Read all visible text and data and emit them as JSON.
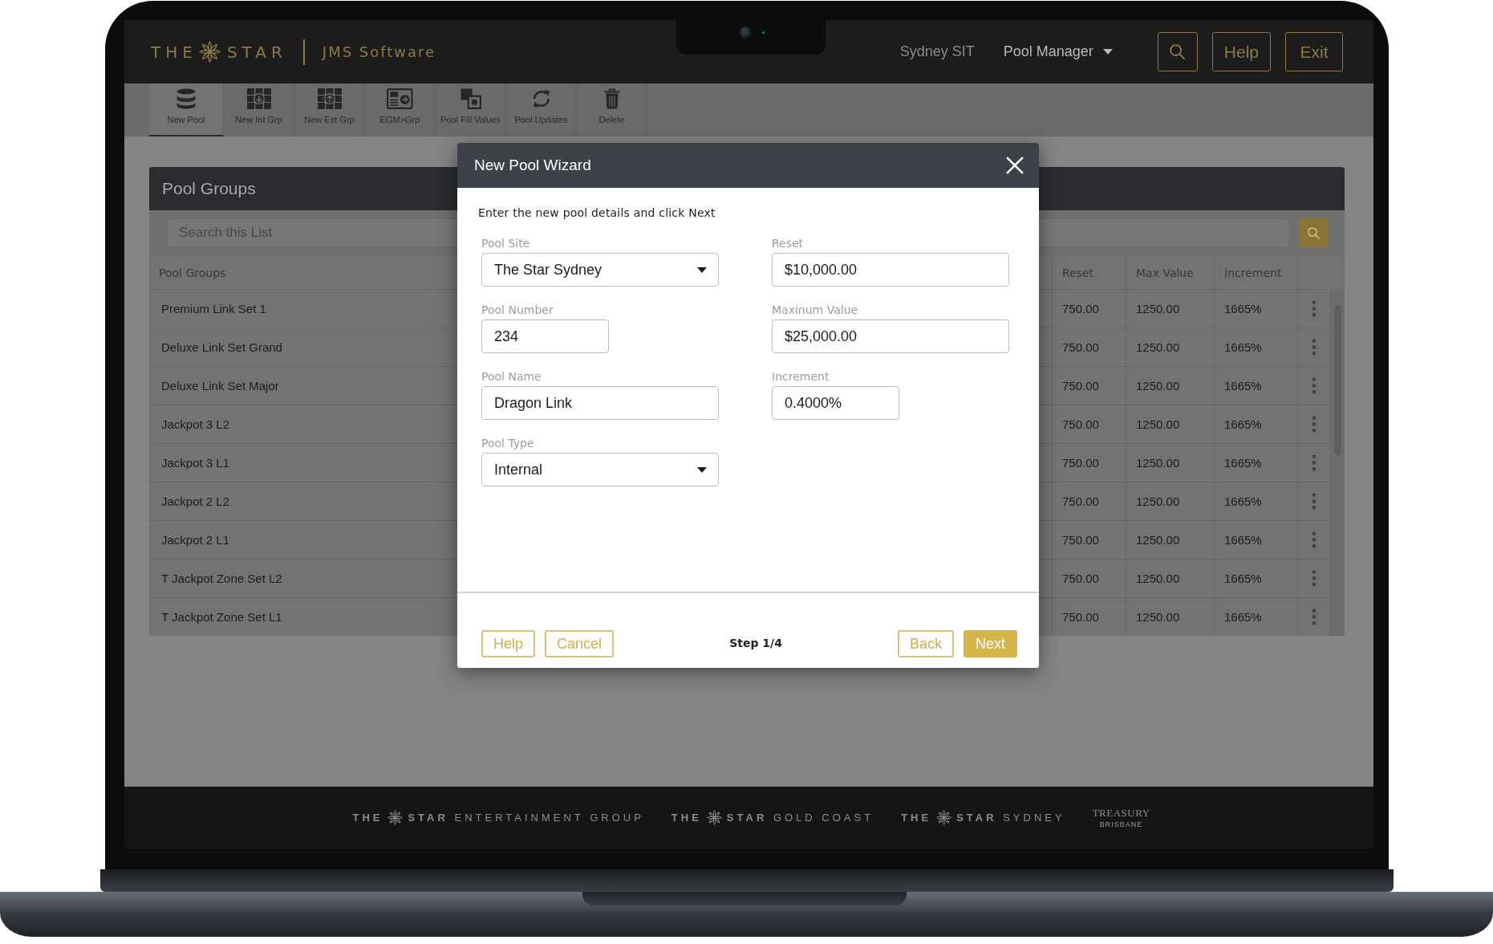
{
  "header": {
    "logo": {
      "lead": "THE",
      "brand": "STAR"
    },
    "app_name": "JMS Software",
    "environment": "Sydney SIT",
    "menu": {
      "label": "Pool Manager"
    },
    "buttons": [
      {
        "kind": "search"
      },
      {
        "kind": "text",
        "label": "Help"
      },
      {
        "kind": "text",
        "label": "Exit"
      }
    ]
  },
  "toolbar": [
    {
      "kind": "database",
      "label": "New Pool",
      "selected": true
    },
    {
      "kind": "group-in",
      "label": "New Int Grp",
      "selected": false
    },
    {
      "kind": "group-out",
      "label": "New Ext Grp",
      "selected": false
    },
    {
      "kind": "machine",
      "label": "EGM>Grp",
      "selected": false
    },
    {
      "kind": "fill",
      "label": "Pool Fill Values",
      "selected": false
    },
    {
      "kind": "refresh",
      "label": "Pool Updates",
      "selected": false
    },
    {
      "kind": "trash",
      "label": "Delete",
      "selected": false
    }
  ],
  "panel": {
    "title": "Pool Groups",
    "search": {
      "placeholder": "Search this List"
    },
    "table": {
      "columns": [
        "Pool Groups",
        "Reset",
        "Max Value",
        "Increment"
      ],
      "rows": [
        {
          "name": "Premium Link Set 1",
          "reset": "750.00",
          "max_value": "1250.00",
          "increment": "1665%"
        },
        {
          "name": "Deluxe Link Set Grand",
          "reset": "750.00",
          "max_value": "1250.00",
          "increment": "1665%"
        },
        {
          "name": "Deluxe Link Set Major",
          "reset": "750.00",
          "max_value": "1250.00",
          "increment": "1665%"
        },
        {
          "name": "Jackpot 3 L2",
          "reset": "750.00",
          "max_value": "1250.00",
          "increment": "1665%"
        },
        {
          "name": "Jackpot 3 L1",
          "reset": "750.00",
          "max_value": "1250.00",
          "increment": "1665%"
        },
        {
          "name": "Jackpot 2 L2",
          "reset": "750.00",
          "max_value": "1250.00",
          "increment": "1665%"
        },
        {
          "name": "Jackpot 2 L1",
          "reset": "750.00",
          "max_value": "1250.00",
          "increment": "1665%"
        },
        {
          "name": "T Jackpot Zone Set L2",
          "reset": "750.00",
          "max_value": "1250.00",
          "increment": "1665%"
        },
        {
          "name": "T Jackpot Zone Set L1",
          "reset": "750.00",
          "max_value": "1250.00",
          "increment": "1665%"
        }
      ]
    }
  },
  "dialog": {
    "title": "New Pool Wizard",
    "instruction": "Enter the new pool details and click Next",
    "columns": [
      [
        {
          "kind": "select",
          "label": "Pool Site",
          "value": "The Star Sydney"
        },
        {
          "kind": "number",
          "label": "Pool Number",
          "value": "234"
        },
        {
          "kind": "text",
          "label": "Pool Name",
          "value": "Dragon Link"
        },
        {
          "kind": "select",
          "label": "Pool Type",
          "value": "Internal"
        }
      ],
      [
        {
          "kind": "currency",
          "label": "Reset",
          "value": "$10,000.00"
        },
        {
          "kind": "currency",
          "label": "Maxinum Value",
          "value": "$25,000.00"
        },
        {
          "kind": "percent",
          "label": "Increment",
          "value": "0.4000%"
        }
      ]
    ],
    "actions": [
      {
        "kind": "outline",
        "label": "Help"
      },
      {
        "kind": "outline",
        "label": "Cancel"
      },
      {
        "kind": "step",
        "label": "Step 1/4"
      },
      {
        "kind": "outline",
        "label": "Back"
      },
      {
        "kind": "primary",
        "label": "Next"
      }
    ]
  },
  "footer": {
    "logos": [
      {
        "kind": "star",
        "lead": "THE",
        "name": "**STAR** ENTERTAINMENT GROUP"
      },
      {
        "kind": "star",
        "lead": "THE",
        "name": "**STAR** GOLD COAST"
      },
      {
        "kind": "star",
        "lead": "THE",
        "name": "**STAR** SYDNEY"
      },
      {
        "kind": "treasury",
        "name": "TREASURY",
        "place": "BRISBANE"
      }
    ]
  }
}
